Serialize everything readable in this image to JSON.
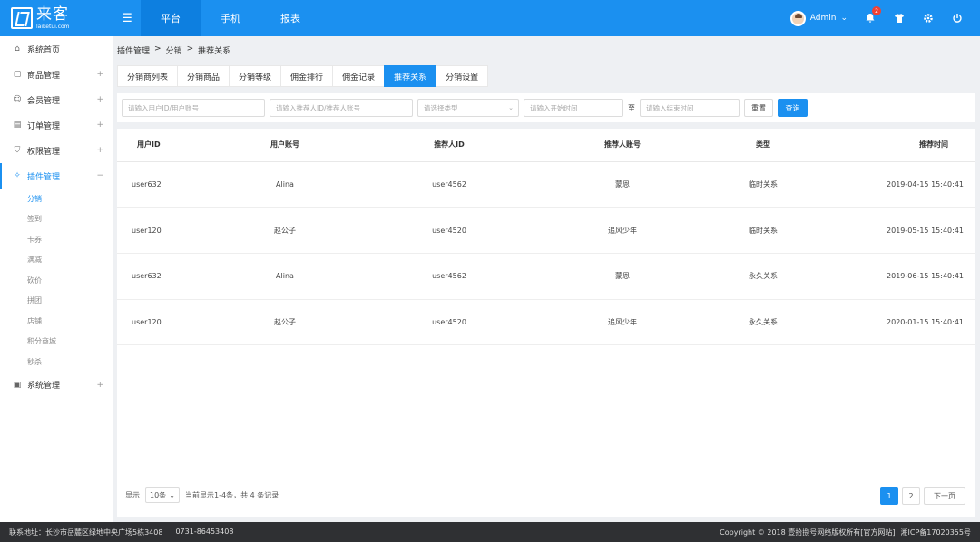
{
  "app": {
    "logo_cn": "来客",
    "logo_en": "laiketui.com"
  },
  "top_nav": [
    "平台",
    "手机",
    "报表"
  ],
  "user": {
    "name": "Admin",
    "notifications": "2"
  },
  "sidebar": {
    "items": [
      {
        "label": "系统首页",
        "icon": "home-icon",
        "expandable": false
      },
      {
        "label": "商品管理",
        "icon": "bag-icon",
        "expandable": true
      },
      {
        "label": "会员管理",
        "icon": "user-icon",
        "expandable": true
      },
      {
        "label": "订单管理",
        "icon": "order-icon",
        "expandable": true
      },
      {
        "label": "权限管理",
        "icon": "shield-icon",
        "expandable": true
      },
      {
        "label": "插件管理",
        "icon": "plugin-icon",
        "expandable": true,
        "expanded_symbol": "−"
      },
      {
        "label": "系统管理",
        "icon": "monitor-icon",
        "expandable": true
      }
    ],
    "sub_items": [
      "分销",
      "签到",
      "卡券",
      "满减",
      "砍价",
      "拼团",
      "店铺",
      "积分商城",
      "秒杀"
    ],
    "plus": "+"
  },
  "breadcrumb": [
    "插件管理",
    ">",
    "分销",
    ">",
    "推荐关系"
  ],
  "tabs": [
    "分销商列表",
    "分销商品",
    "分销等级",
    "佣金排行",
    "佣金记录",
    "推荐关系",
    "分销设置"
  ],
  "filter": {
    "user_placeholder": "请输入用户ID/用户账号",
    "referrer_placeholder": "请输入推荐人ID/推荐人账号",
    "type_placeholder": "请选择类型",
    "start_placeholder": "请输入开始时间",
    "to_label": "至",
    "end_placeholder": "请输入结束时间",
    "reset_label": "重置",
    "query_label": "查询"
  },
  "table": {
    "headers": [
      "用户ID",
      "用户账号",
      "推荐人ID",
      "推荐人账号",
      "类型",
      "推荐时间"
    ],
    "rows": [
      [
        "user632",
        "Alina",
        "user4562",
        "蒙恩",
        "临时关系",
        "2019-04-15 15:40:41"
      ],
      [
        "user120",
        "赵公子",
        "user4520",
        "追风少年",
        "临时关系",
        "2019-05-15 15:40:41"
      ],
      [
        "user632",
        "Alina",
        "user4562",
        "蒙恩",
        "永久关系",
        "2019-06-15 15:40:41"
      ],
      [
        "user120",
        "赵公子",
        "user4520",
        "追风少年",
        "永久关系",
        "2020-01-15 15:40:41"
      ]
    ]
  },
  "pager": {
    "show_label": "显示",
    "page_size": "10条",
    "summary": "当前显示1-4条，共 4 条记录",
    "pages": [
      "1",
      "2"
    ],
    "next": "下一页"
  },
  "footer": {
    "address": "联系地址：长沙市岳麓区绿地中央广场5栋3408",
    "phone": "0731-86453408",
    "copyright": "Copyright © 2018 壹拾捌号网络版权所有[官方网站]",
    "icp": "湘ICP备17020355号"
  },
  "colors": {
    "primary": "#1b90f0",
    "footer": "#2f3033"
  }
}
